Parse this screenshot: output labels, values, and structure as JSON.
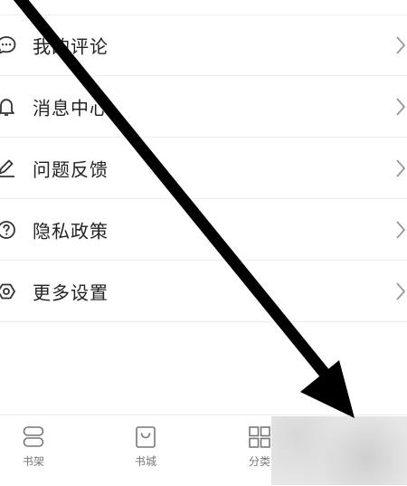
{
  "menu": {
    "items": [
      {
        "label": "我的评论",
        "icon": "comment-icon"
      },
      {
        "label": "消息中心",
        "icon": "bell-icon"
      },
      {
        "label": "问题反馈",
        "icon": "pen-icon"
      },
      {
        "label": "隐私政策",
        "icon": "question-icon"
      },
      {
        "label": "更多设置",
        "icon": "settings-icon"
      }
    ]
  },
  "tabbar": {
    "shelf": {
      "label": "书架",
      "icon": "bookshelf-icon"
    },
    "store": {
      "label": "书城",
      "icon": "bag-icon"
    },
    "category": {
      "label": "分类",
      "icon": "grid-icon"
    }
  },
  "annotation": {
    "arrow_color": "#000000"
  }
}
